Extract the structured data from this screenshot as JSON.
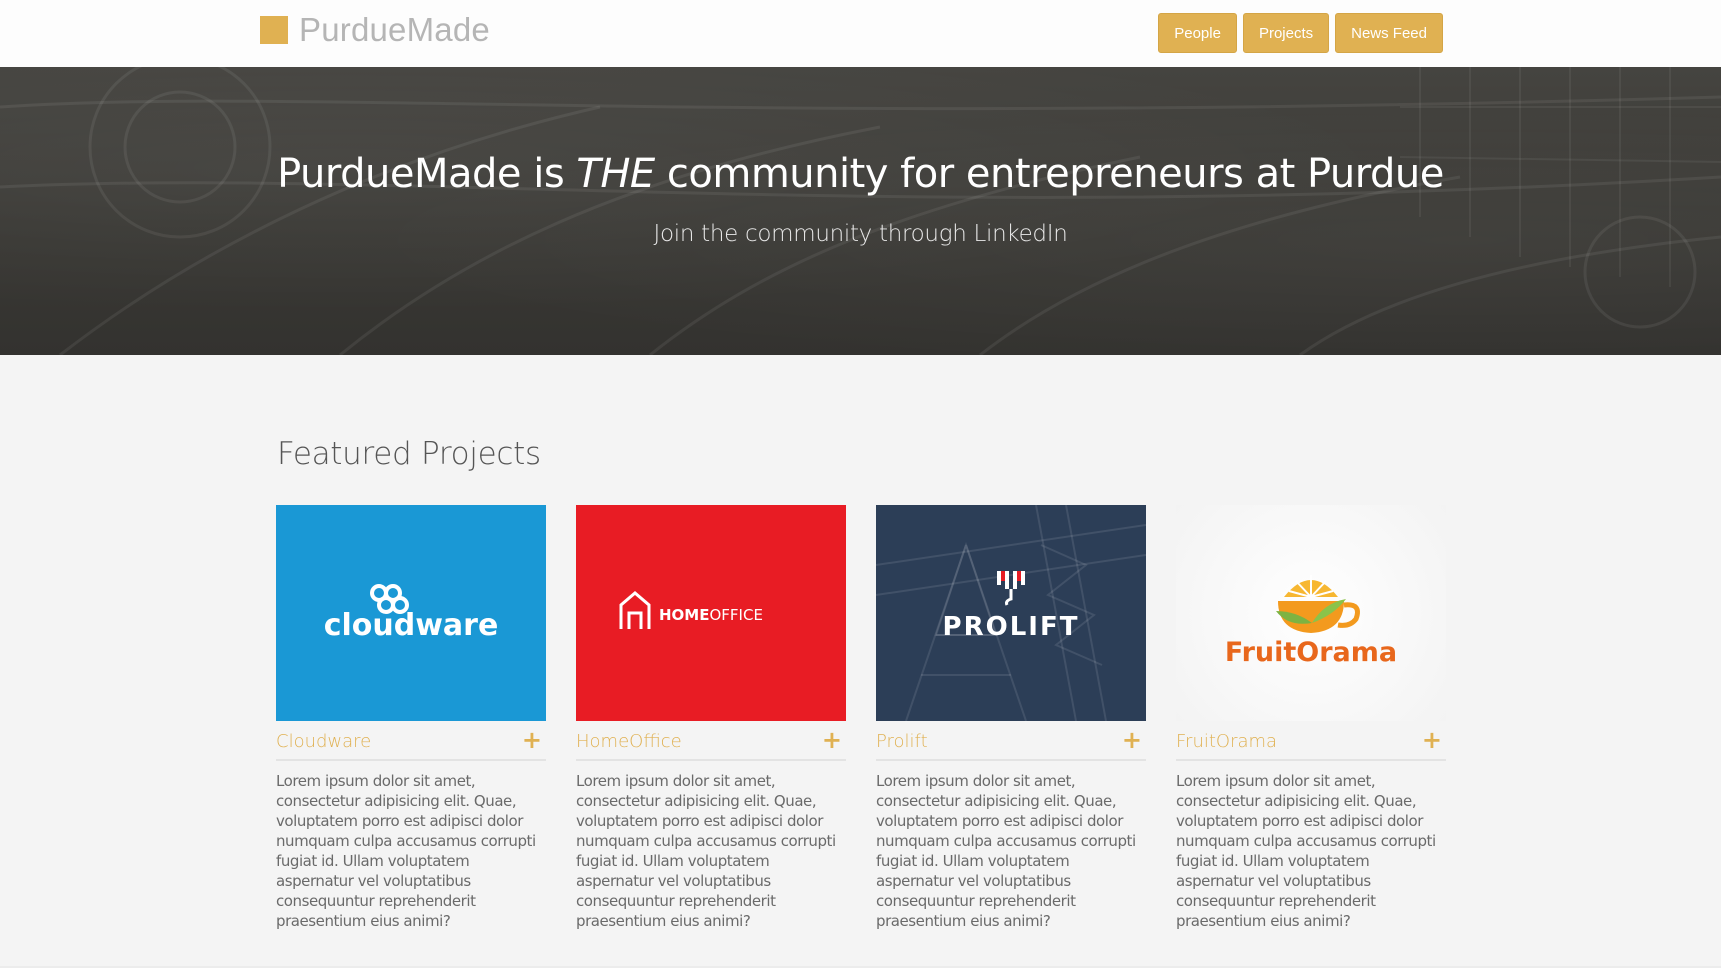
{
  "header": {
    "brand": "PurdueMade",
    "nav": [
      "People",
      "Projects",
      "News Feed"
    ]
  },
  "hero": {
    "title_before": "PurdueMade is ",
    "title_emphasis": "THE",
    "title_after": " community for entrepreneurs at Purdue",
    "subtitle": "Join the community through LinkedIn"
  },
  "featured": {
    "title": "Featured Projects",
    "projects": [
      {
        "name": "Cloudware",
        "logo_text": "cloudware",
        "bg": "#1a98d5",
        "description": "Lorem ipsum dolor sit amet, consectetur adipisicing elit. Quae, voluptatem porro est adipisci dolor numquam culpa accusamus corrupti fugiat id. Ullam voluptatem aspernatur vel voluptatibus consequuntur reprehenderit praesentium eius animi?"
      },
      {
        "name": "HomeOffice",
        "logo_text_bold": "HOME",
        "logo_text_light": "OFFICE",
        "bg": "#e81c24",
        "description": "Lorem ipsum dolor sit amet, consectetur adipisicing elit. Quae, voluptatem porro est adipisci dolor numquam culpa accusamus corrupti fugiat id. Ullam voluptatem aspernatur vel voluptatibus consequuntur reprehenderit praesentium eius animi?"
      },
      {
        "name": "Prolift",
        "logo_text": "PROLIFT",
        "bg": "#2c3e57",
        "description": "Lorem ipsum dolor sit amet, consectetur adipisicing elit. Quae, voluptatem porro est adipisci dolor numquam culpa accusamus corrupti fugiat id. Ullam voluptatem aspernatur vel voluptatibus consequuntur reprehenderit praesentium eius animi?"
      },
      {
        "name": "FruitOrama",
        "logo_text": "FruitOrama",
        "bg": "#f6f6f6",
        "description": "Lorem ipsum dolor sit amet, consectetur adipisicing elit. Quae, voluptatem porro est adipisci dolor numquam culpa accusamus corrupti fugiat id. Ullam voluptatem aspernatur vel voluptatibus consequuntur reprehenderit praesentium eius animi?"
      }
    ],
    "expand_symbol": "+"
  },
  "colors": {
    "accent": "#e0b152",
    "hero_bg": "#3a3935"
  }
}
